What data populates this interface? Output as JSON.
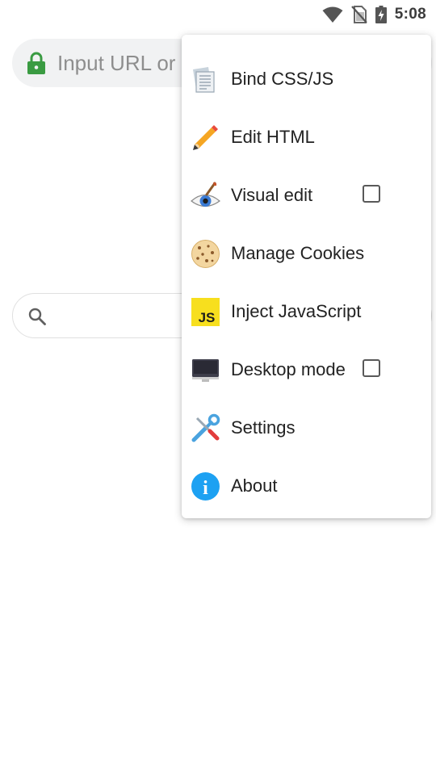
{
  "status_bar": {
    "time": "5:08",
    "icons": [
      "wifi-icon",
      "no-sim-icon",
      "battery-charging-icon"
    ]
  },
  "url_bar": {
    "lock_icon": "lock-icon",
    "placeholder": "Input URL or"
  },
  "search": {
    "icon": "search-icon"
  },
  "menu": {
    "items": [
      {
        "label": "Bind CSS/JS",
        "icon": "document-icon"
      },
      {
        "label": "Edit HTML",
        "icon": "pencil-icon"
      },
      {
        "label": "Visual edit",
        "icon": "eye-brush-icon",
        "checkbox": false
      },
      {
        "label": "Manage Cookies",
        "icon": "cookie-icon"
      },
      {
        "label": "Inject JavaScript",
        "icon": "js-icon",
        "icon_text": "JS"
      },
      {
        "label": "Desktop mode",
        "icon": "monitor-icon",
        "checkbox": false
      },
      {
        "label": "Settings",
        "icon": "tools-icon"
      },
      {
        "label": "About",
        "icon": "info-icon",
        "icon_text": "i"
      }
    ]
  },
  "colors": {
    "lock_green": "#3a9b42",
    "js_yellow": "#f7df1e",
    "info_blue": "#1da1f2",
    "menu_text": "#222222",
    "placeholder": "#8e8e8e"
  }
}
